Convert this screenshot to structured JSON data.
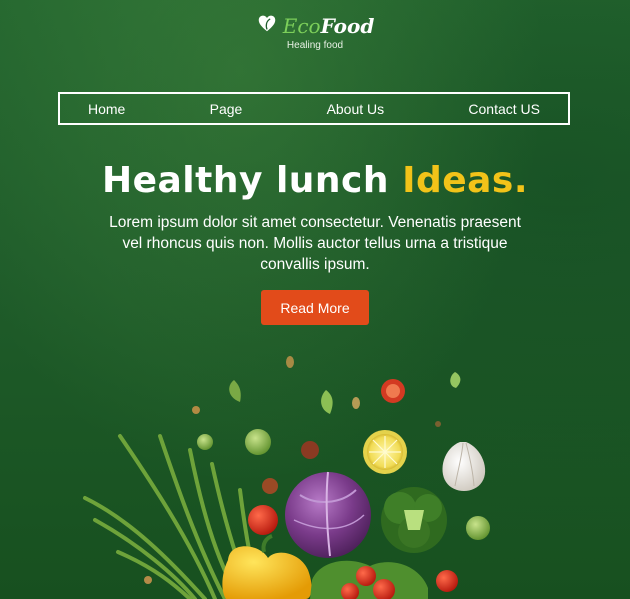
{
  "brand": {
    "name_part1": "Eco",
    "name_part2": "Food",
    "tagline": "Healing food",
    "accent_color": "#7ccf5a"
  },
  "nav": {
    "items": [
      "Home",
      "Page",
      "About Us",
      "Contact US"
    ]
  },
  "hero": {
    "headline_main": "Healthy lunch ",
    "headline_accent": "Ideas.",
    "accent_color": "#f2c319",
    "body": "Lorem ipsum dolor sit amet consectetur. Venenatis praesent vel rhoncus quis non. Mollis auctor tellus urna a tristique convallis ipsum.",
    "cta_label": "Read More",
    "cta_color": "#e24b1a"
  },
  "illustration": {
    "icon": "vegetables-illustration"
  }
}
